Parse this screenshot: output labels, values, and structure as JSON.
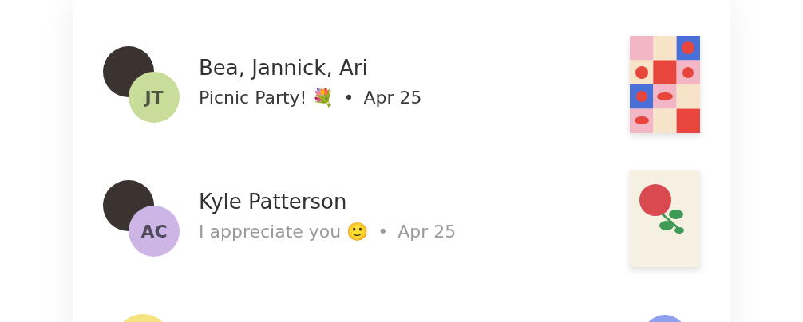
{
  "conversations": [
    {
      "title": "Bea, Jannick, Ari",
      "preview": "Picnic Party! 💐",
      "separator": "•",
      "date": "Apr 25",
      "unread": true,
      "photo_avatar": true,
      "initials": "JT",
      "color": "#c9dd9b",
      "thumbnail": {
        "kind": "save-the-date"
      }
    },
    {
      "title": "Kyle Patterson",
      "preview": "I appreciate you 🙂",
      "separator": "•",
      "date": "Apr 25",
      "unread": false,
      "photo_avatar": true,
      "initials": "AC",
      "color": "#cdb6e6",
      "thumbnail": {
        "kind": "rose"
      }
    },
    {
      "photo_avatar": false,
      "color": "#f4e37e",
      "thumbnail": {
        "kind": "round"
      }
    }
  ]
}
